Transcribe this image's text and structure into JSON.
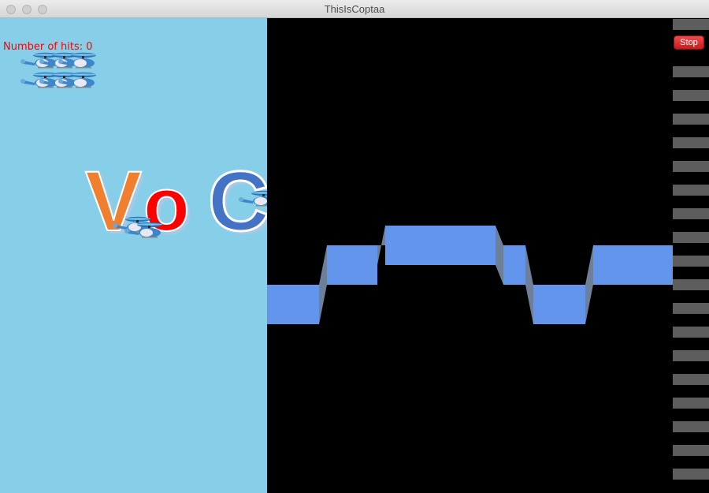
{
  "window": {
    "title": "ThisIsCoptaa"
  },
  "hud": {
    "hits_text": "Number of hits: 0"
  },
  "logo": {
    "letters": [
      "V",
      "o",
      "C"
    ]
  },
  "controls": {
    "stop_label": "Stop"
  },
  "colors": {
    "sky": "#87cfe9",
    "terrain": "#6495ed",
    "terrain_side": "#6e7f99",
    "logo_v": "#f08030",
    "logo_o": "#ff0000",
    "logo_c": "#4472c4",
    "hud_text": "#ff0000",
    "stop_button": "#e02b2b"
  },
  "icons": {
    "helicopter": "helicopter-icon"
  }
}
